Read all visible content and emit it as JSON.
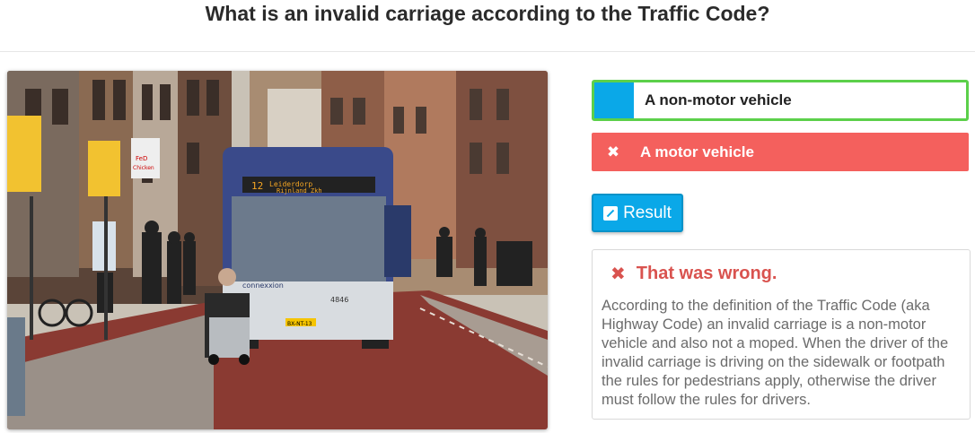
{
  "question": "What is an invalid carriage according to the Traffic Code?",
  "answers": [
    {
      "label": "A non-motor vehicle",
      "state": "correct",
      "swatch_color": "#0aa8e8"
    },
    {
      "label": "A motor vehicle",
      "state": "wrong-selected",
      "icon": "x-icon"
    }
  ],
  "result_button": {
    "label": "Result",
    "icon": "external-link-icon"
  },
  "feedback": {
    "title": "That was wrong.",
    "icon": "x-icon",
    "text": "According to the definition of the Traffic Code (aka Highway Code) an invalid carriage is a non-motor vehicle and also not a moped. When the driver of the invalid carriage is driving on the sidewalk or footpath the rules for pedestrians apply, otherwise the driver must follow the rules for drivers."
  },
  "photo": {
    "bus_destination": "Leiderdorp Rijnland Zkh",
    "bus_route": "12",
    "bus_brand": "connexxion",
    "bus_number": "4846",
    "bus_plate": "BX-NT-13",
    "shop_sign": "FeD Chicken"
  },
  "colors": {
    "correct_border": "#5cd04a",
    "wrong_bg": "#f4605d",
    "accent": "#0aa8e8",
    "error_text": "#d9534f"
  }
}
